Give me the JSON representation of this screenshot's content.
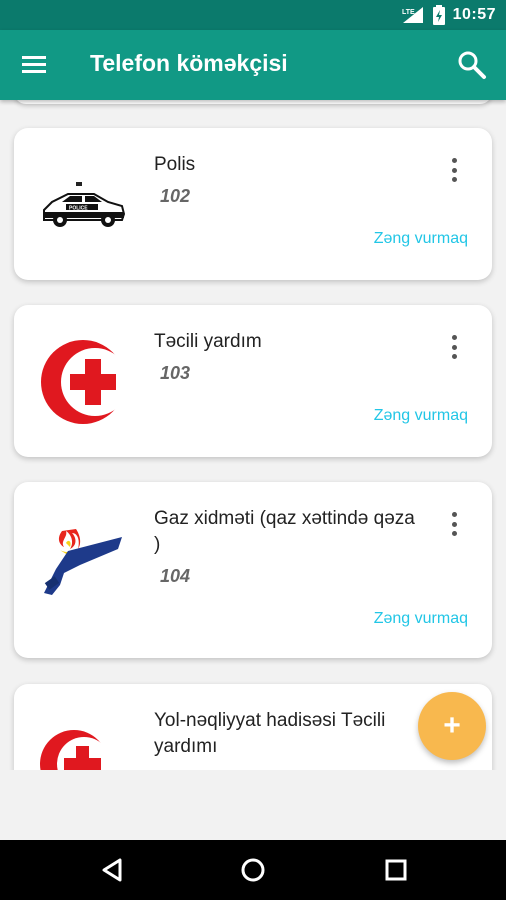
{
  "status_bar": {
    "time": "10:57",
    "network": "LTE"
  },
  "app_bar": {
    "title": "Telefon köməkçisi",
    "menu_icon": "hamburger-menu-icon",
    "search_icon": "search-icon"
  },
  "cards": [
    {
      "title": "Polis",
      "number": "102",
      "action": "Zəng vurmaq",
      "icon": "police-car-icon"
    },
    {
      "title": "Təcili yardım",
      "number": "103",
      "action": "Zəng vurmaq",
      "icon": "red-crescent-icon"
    },
    {
      "title": "Gaz xidməti (qaz xəttində qəza )",
      "number": "104",
      "action": "Zəng vurmaq",
      "icon": "gas-pipe-fire-icon"
    },
    {
      "title": "Yol-nəqliyyat hadisəsi Təcili yardımı",
      "icon": "road-accident-ambulance-icon"
    }
  ],
  "fab": {
    "label": "+"
  },
  "colors": {
    "app_bar": "#119985",
    "status_bar": "#0b7a6c",
    "accent": "#22c6e6",
    "fab": "#f8b84e",
    "crescent": "#e0181f"
  }
}
